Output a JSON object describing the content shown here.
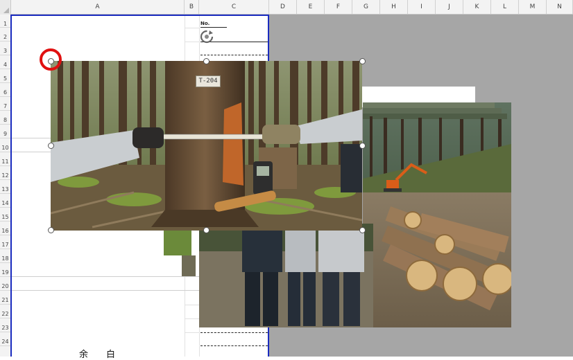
{
  "columns": [
    "A",
    "B",
    "C",
    "D",
    "E",
    "F",
    "G",
    "H",
    "I",
    "J",
    "K",
    "L",
    "M",
    "N"
  ],
  "rows": [
    "1",
    "2",
    "3",
    "4",
    "5",
    "6",
    "7",
    "8",
    "9",
    "10",
    "11",
    "12",
    "13",
    "14",
    "15",
    "16",
    "17",
    "18",
    "19",
    "20",
    "21",
    "22",
    "23",
    "24"
  ],
  "sheet": {
    "no_label": "No.",
    "yohaku": "余白"
  },
  "photo_main": {
    "tree_tag": "T-204"
  },
  "colors": {
    "print_border": "#1a2bbf",
    "outside_gray": "#a6a6a6",
    "highlight": "#e01010"
  },
  "icons": {
    "rotate_handle": "rotate-icon"
  }
}
